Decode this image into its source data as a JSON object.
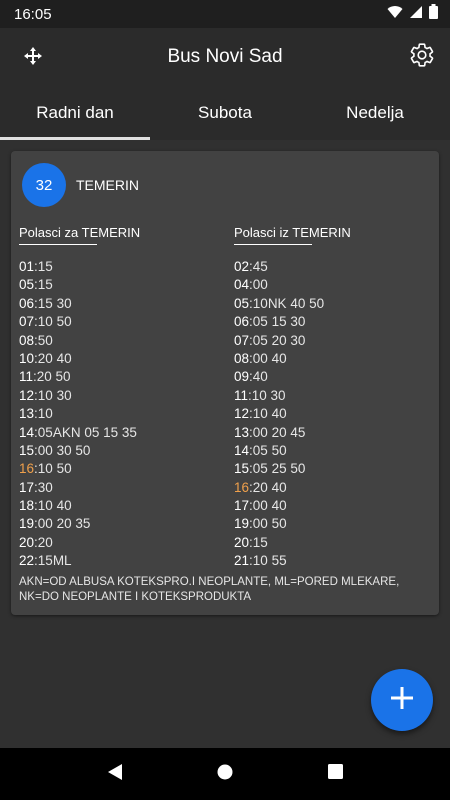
{
  "status": {
    "time": "16:05"
  },
  "app": {
    "title": "Bus Novi Sad"
  },
  "tabs": [
    {
      "label": "Radni dan",
      "active": true
    },
    {
      "label": "Subota",
      "active": false
    },
    {
      "label": "Nedelja",
      "active": false
    }
  ],
  "route": {
    "number": "32",
    "name": "TEMERIN",
    "departures_to": {
      "heading": "Polasci za  TEMERIN",
      "rows": [
        {
          "hour": "01",
          "mins": "15",
          "highlight": false
        },
        {
          "hour": "05",
          "mins": "15",
          "highlight": false
        },
        {
          "hour": "06",
          "mins": "15 30",
          "highlight": false
        },
        {
          "hour": "07",
          "mins": "10 50",
          "highlight": false
        },
        {
          "hour": "08",
          "mins": "50",
          "highlight": false
        },
        {
          "hour": "10",
          "mins": "20 40",
          "highlight": false
        },
        {
          "hour": "11",
          "mins": "20 50",
          "highlight": false
        },
        {
          "hour": "12",
          "mins": "10 30",
          "highlight": false
        },
        {
          "hour": "13",
          "mins": "10",
          "highlight": false
        },
        {
          "hour": "14",
          "mins": "05AKN 05 15 35",
          "highlight": false
        },
        {
          "hour": "15",
          "mins": "00 30 50",
          "highlight": false
        },
        {
          "hour": "16",
          "mins": "10 50",
          "highlight": true
        },
        {
          "hour": "17",
          "mins": "30",
          "highlight": false
        },
        {
          "hour": "18",
          "mins": "10 40",
          "highlight": false
        },
        {
          "hour": "19",
          "mins": "00 20 35",
          "highlight": false
        },
        {
          "hour": "20",
          "mins": "20",
          "highlight": false
        },
        {
          "hour": "22",
          "mins": "15ML",
          "highlight": false
        }
      ]
    },
    "departures_from": {
      "heading": "Polasci iz  TEMERIN",
      "rows": [
        {
          "hour": "02",
          "mins": "45",
          "highlight": false
        },
        {
          "hour": "04",
          "mins": "00",
          "highlight": false
        },
        {
          "hour": "05",
          "mins": "10NK 40 50",
          "highlight": false
        },
        {
          "hour": "06",
          "mins": "05 15 30",
          "highlight": false
        },
        {
          "hour": "07",
          "mins": "05 20 30",
          "highlight": false
        },
        {
          "hour": "08",
          "mins": "00 40",
          "highlight": false
        },
        {
          "hour": "09",
          "mins": "40",
          "highlight": false
        },
        {
          "hour": "11",
          "mins": "10 30",
          "highlight": false
        },
        {
          "hour": "12",
          "mins": "10 40",
          "highlight": false
        },
        {
          "hour": "13",
          "mins": "00 20 45",
          "highlight": false
        },
        {
          "hour": "14",
          "mins": "05 50",
          "highlight": false
        },
        {
          "hour": "15",
          "mins": "05 25 50",
          "highlight": false
        },
        {
          "hour": "16",
          "mins": "20 40",
          "highlight": true
        },
        {
          "hour": "17",
          "mins": "00 40",
          "highlight": false
        },
        {
          "hour": "19",
          "mins": "00 50",
          "highlight": false
        },
        {
          "hour": "20",
          "mins": "15",
          "highlight": false
        },
        {
          "hour": "21",
          "mins": "10 55",
          "highlight": false
        }
      ]
    },
    "note": "AKN=OD ALBUSA KOTEKSPRO.I NEOPLANTE,  ML=PORED MLEKARE, NK=DO NEOPLANTE I KOTEKSPRODUKTA"
  },
  "icons": {
    "move": "move-arrows-icon",
    "settings": "gear-icon",
    "add": "plus-icon",
    "wifi": "wifi-icon",
    "signal": "signal-icon",
    "battery": "battery-icon",
    "back": "back-triangle-icon",
    "home": "home-circle-icon",
    "recents": "recents-square-icon"
  },
  "colors": {
    "accent": "#1a73e8",
    "highlight_hour": "#f0a04b",
    "background": "#303030",
    "card": "#424242"
  }
}
